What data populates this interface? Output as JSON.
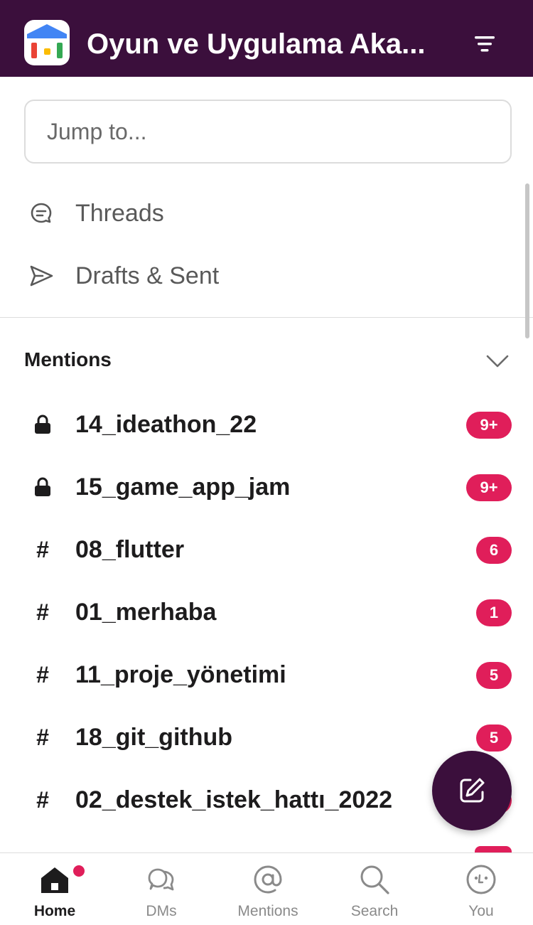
{
  "header": {
    "workspace_name": "Oyun ve Uygulama Aka...",
    "filter_icon": "filter-icon",
    "workspace_icon": "workspace-logo-icon"
  },
  "search": {
    "placeholder": "Jump to..."
  },
  "nav": [
    {
      "label": "Threads",
      "icon": "threads-icon"
    },
    {
      "label": "Drafts & Sent",
      "icon": "send-icon"
    }
  ],
  "mentions": {
    "title": "Mentions",
    "channels": [
      {
        "name": "14_ideathon_22",
        "private": true,
        "badge": "9+"
      },
      {
        "name": "15_game_app_jam",
        "private": true,
        "badge": "9+"
      },
      {
        "name": "08_flutter",
        "private": false,
        "badge": "6"
      },
      {
        "name": "01_merhaba",
        "private": false,
        "badge": "1"
      },
      {
        "name": "11_proje_yönetimi",
        "private": false,
        "badge": "5"
      },
      {
        "name": "18_git_github",
        "private": false,
        "badge": "5"
      },
      {
        "name": "02_destek_istek_hattı_2022",
        "private": false,
        "badge": ""
      }
    ]
  },
  "fab": {
    "icon": "compose-icon"
  },
  "tabs": [
    {
      "label": "Home",
      "icon": "home-icon",
      "active": true
    },
    {
      "label": "DMs",
      "icon": "dms-icon",
      "active": false
    },
    {
      "label": "Mentions",
      "icon": "at-icon",
      "active": false
    },
    {
      "label": "Search",
      "icon": "search-icon",
      "active": false
    },
    {
      "label": "You",
      "icon": "profile-icon",
      "active": false
    }
  ],
  "colors": {
    "header_bg": "#3b0f3c",
    "badge": "#e01e5a"
  },
  "chars": {
    "hash": "#"
  }
}
